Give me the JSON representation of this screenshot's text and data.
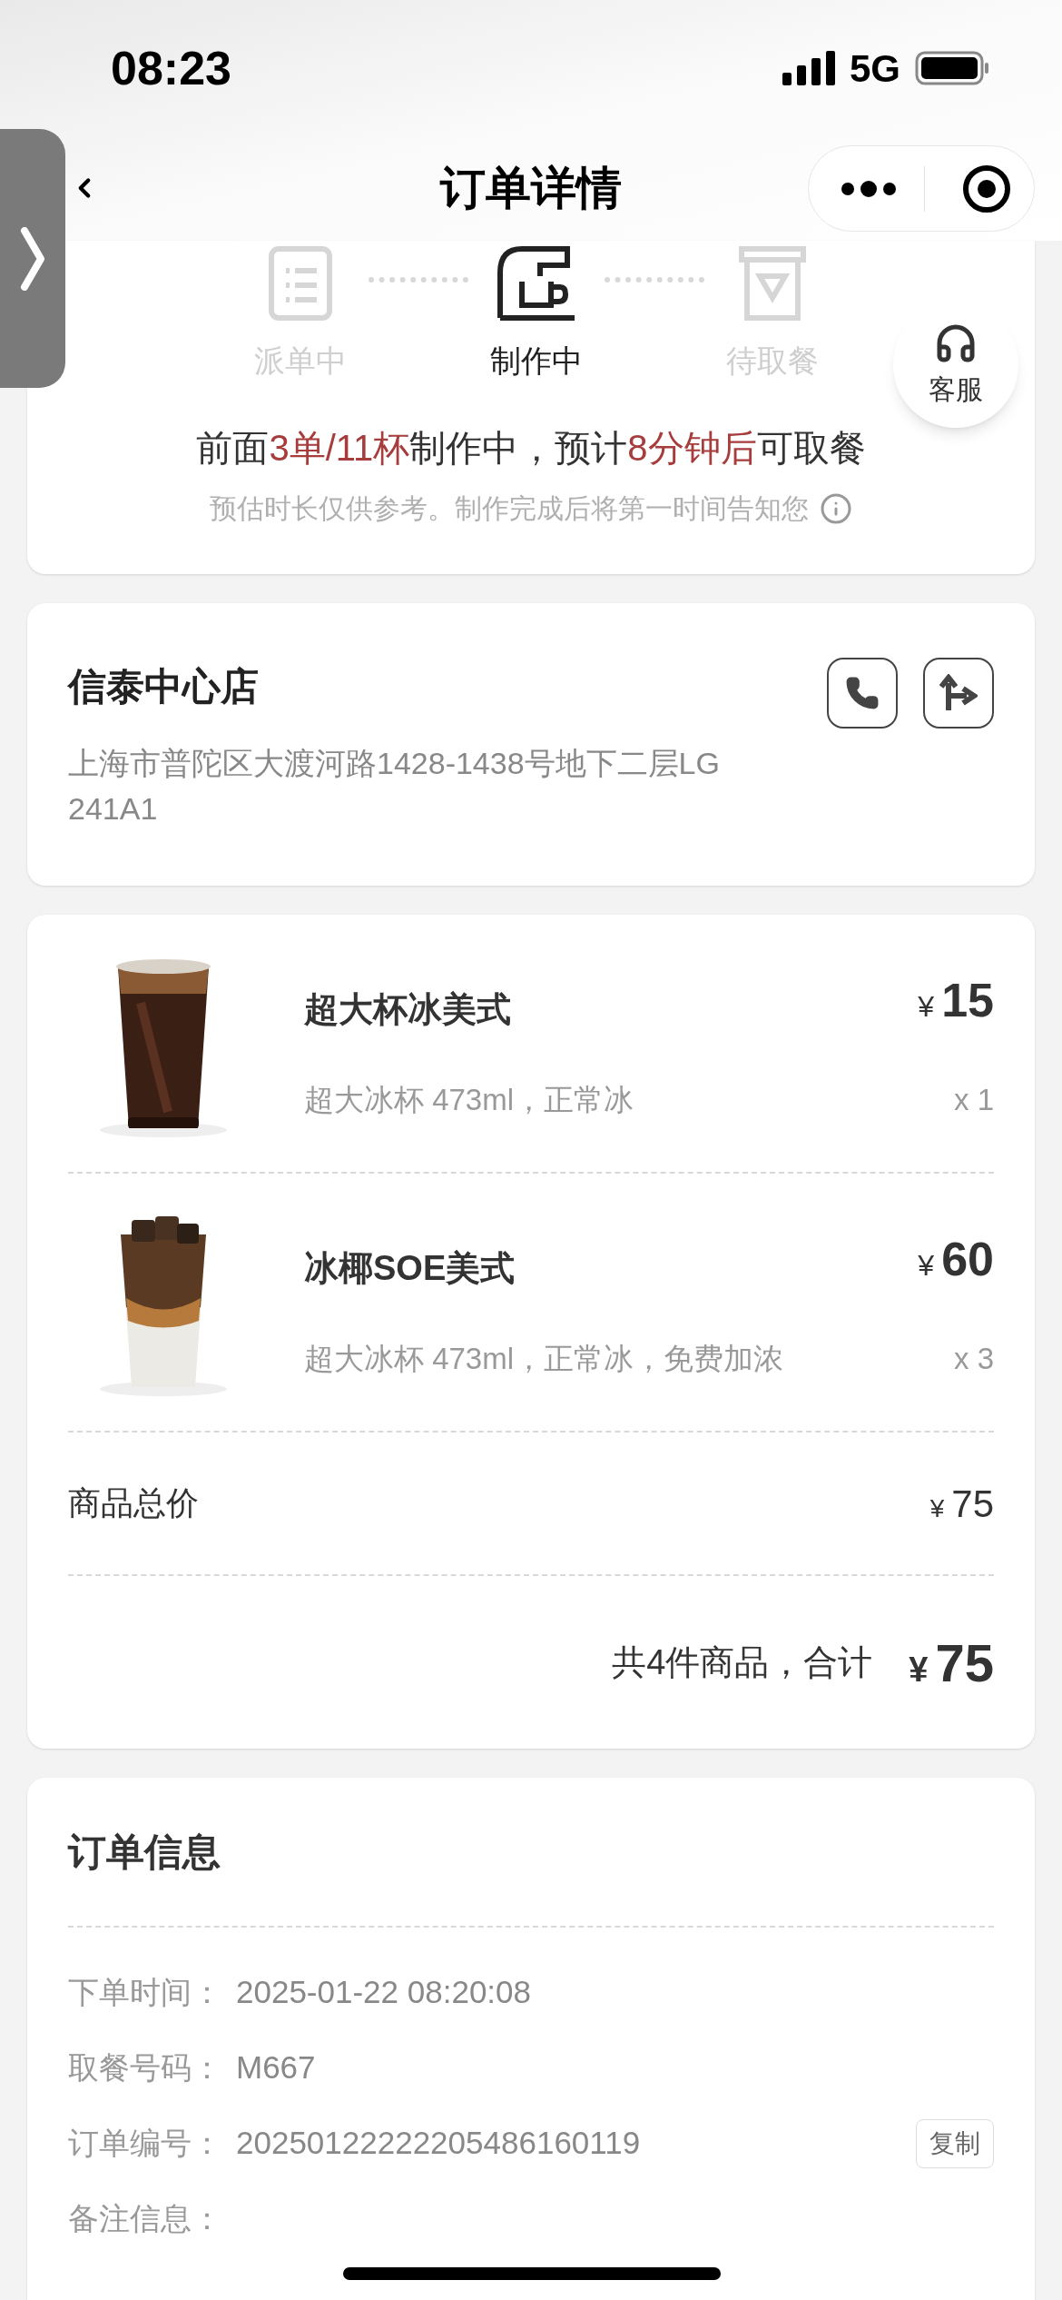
{
  "status_bar": {
    "time": "08:23",
    "network": "5G"
  },
  "nav": {
    "title": "订单详情"
  },
  "progress": {
    "steps": [
      {
        "label": "派单中",
        "kind": "list",
        "selected": false
      },
      {
        "label": "制作中",
        "kind": "machine",
        "selected": true
      },
      {
        "label": "待取餐",
        "kind": "cup",
        "selected": false
      }
    ],
    "service_label": "客服",
    "notice": "前面**3单/11杯**制作中，预计**8分钟后**可取餐",
    "hint": "预估时长仅供参考。制作完成后将第一时间告知您"
  },
  "store": {
    "name": "信泰中心店",
    "address": "上海市普陀区大渡河路1428-1438号地下二层LG 241A1"
  },
  "items": [
    {
      "name": "超大杯冰美式",
      "currency": "¥",
      "price": "15",
      "spec": "超大冰杯 473ml，正常冰",
      "qty": "x 1",
      "kind": "dark"
    },
    {
      "name": "冰椰SOE美式",
      "currency": "¥",
      "price": "60",
      "spec": "超大冰杯 473ml，正常冰，免费加浓",
      "qty": "x 3",
      "kind": "layered"
    }
  ],
  "subtotal": {
    "label": "商品总价",
    "currency": "¥",
    "value": "75"
  },
  "total": {
    "label": "共4件商品，合计",
    "currency": "¥",
    "value": "75"
  },
  "order_info": {
    "title": "订单信息",
    "rows": [
      {
        "label": "下单时间：",
        "value": "2025-01-22 08:20:08"
      },
      {
        "label": "取餐号码：",
        "value": "M667"
      },
      {
        "label": "订单编号：",
        "value": "20250122222205486160119",
        "action": "复制"
      },
      {
        "label": "备注信息："
      }
    ]
  }
}
